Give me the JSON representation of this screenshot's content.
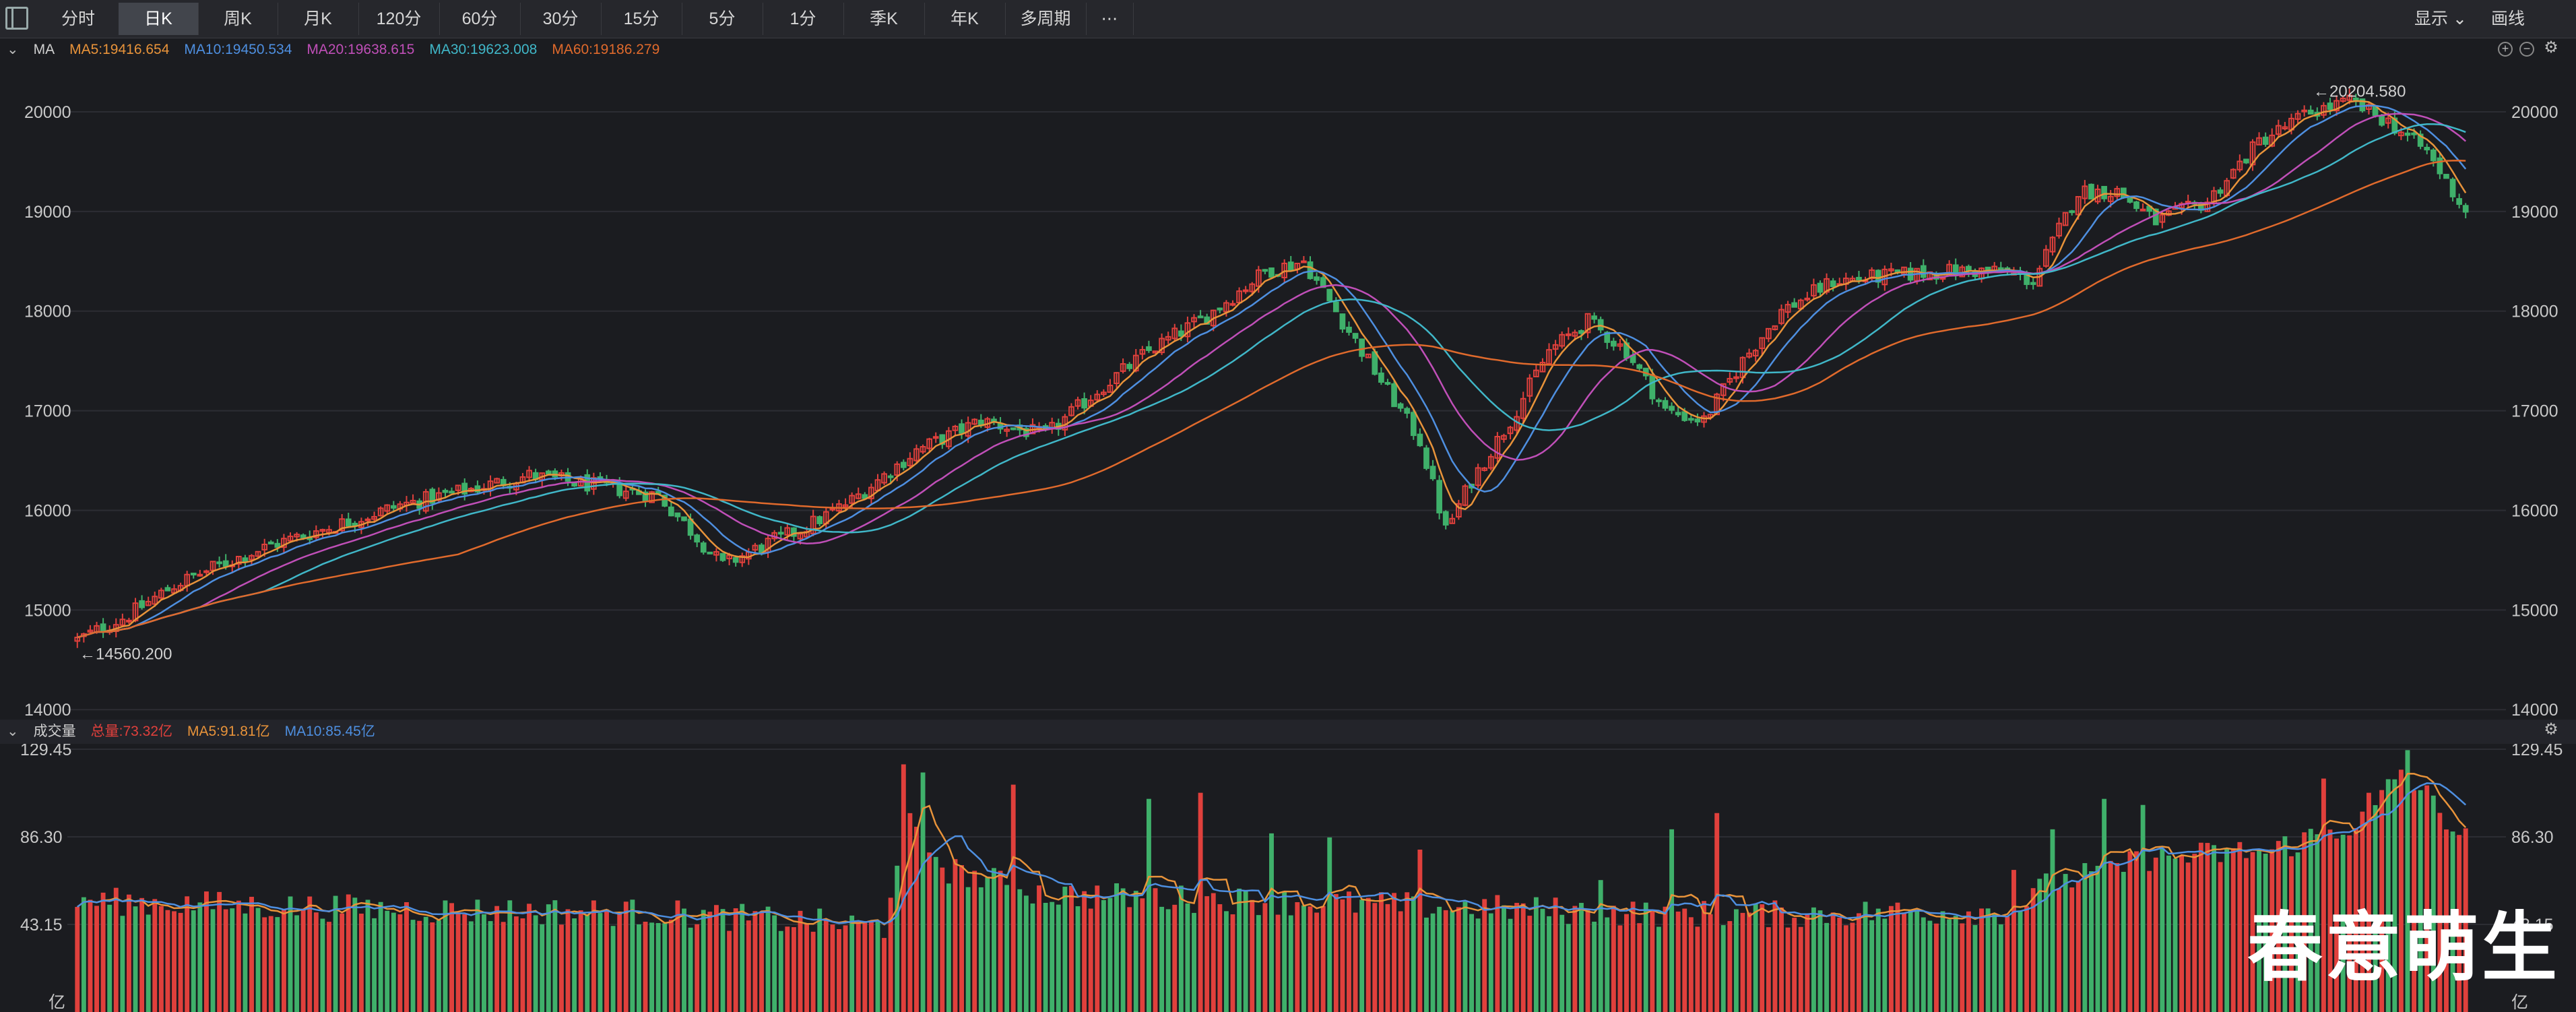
{
  "toolbar": {
    "tabs": [
      "分时",
      "日K",
      "周K",
      "月K",
      "120分",
      "60分",
      "30分",
      "15分",
      "5分",
      "1分",
      "季K",
      "年K",
      "多周期",
      "⋯"
    ],
    "active_tab": 1,
    "display_label": "显示",
    "draw_label": "画线"
  },
  "indicators": {
    "ma_title": "MA",
    "ma5": "MA5:19416.654",
    "ma10": "MA10:19450.534",
    "ma20": "MA20:19638.615",
    "ma30": "MA30:19623.008",
    "ma60": "MA60:19186.279",
    "vol_title": "成交量",
    "vol_total": "总量:73.32亿",
    "vol_ma5": "MA5:91.81亿",
    "vol_ma10": "MA10:85.45亿"
  },
  "colors": {
    "up": "#e0403c",
    "down": "#3fb06a",
    "ma5": "#e8933a",
    "ma10": "#4e8fe0",
    "ma20": "#c04fb8",
    "ma30": "#40b7c8",
    "ma60": "#e06a2c"
  },
  "watermark": "春意萌生",
  "chart_data": [
    {
      "type": "candlestick",
      "title": "",
      "y_ticks": [
        "20000",
        "19000",
        "18000",
        "17000",
        "16000",
        "15000",
        "14000"
      ],
      "ylim": [
        13900,
        20500
      ],
      "grid": true,
      "annotations": [
        {
          "label": "←20204.580",
          "value": 20204.58
        },
        {
          "label": "←14560.200",
          "value": 14560.2
        }
      ],
      "keypoints": [
        [
          0,
          14700
        ],
        [
          8,
          14950
        ],
        [
          15,
          15250
        ],
        [
          22,
          15450
        ],
        [
          30,
          15650
        ],
        [
          40,
          15850
        ],
        [
          50,
          16050
        ],
        [
          60,
          16200
        ],
        [
          70,
          16350
        ],
        [
          80,
          16250
        ],
        [
          90,
          16150
        ],
        [
          100,
          15450
        ],
        [
          108,
          15700
        ],
        [
          112,
          15800
        ],
        [
          120,
          16100
        ],
        [
          130,
          16600
        ],
        [
          140,
          16900
        ],
        [
          150,
          16750
        ],
        [
          158,
          17200
        ],
        [
          166,
          17600
        ],
        [
          175,
          17950
        ],
        [
          184,
          18400
        ],
        [
          190,
          18500
        ],
        [
          196,
          17900
        ],
        [
          202,
          17300
        ],
        [
          208,
          16700
        ],
        [
          212,
          15800
        ],
        [
          216,
          16300
        ],
        [
          222,
          16900
        ],
        [
          228,
          17600
        ],
        [
          234,
          17900
        ],
        [
          240,
          17600
        ],
        [
          246,
          17000
        ],
        [
          252,
          16900
        ],
        [
          258,
          17500
        ],
        [
          264,
          18000
        ],
        [
          272,
          18300
        ],
        [
          280,
          18350
        ],
        [
          290,
          18400
        ],
        [
          298,
          18400
        ],
        [
          303,
          18300
        ],
        [
          310,
          19200
        ],
        [
          316,
          19200
        ],
        [
          322,
          18900
        ],
        [
          330,
          19100
        ],
        [
          338,
          19700
        ],
        [
          346,
          20000
        ],
        [
          352,
          20100
        ],
        [
          358,
          19900
        ],
        [
          364,
          19600
        ],
        [
          370,
          19000
        ]
      ],
      "ma_windows": [
        5,
        10,
        20,
        30,
        60
      ]
    },
    {
      "type": "bar",
      "title": "",
      "y_ticks": [
        "129.45",
        "86.30",
        "43.15",
        "亿"
      ],
      "unit": "亿",
      "ylim": [
        0,
        129.45
      ],
      "keypoints": [
        [
          0,
          55
        ],
        [
          30,
          52
        ],
        [
          60,
          50
        ],
        [
          90,
          49
        ],
        [
          110,
          45
        ],
        [
          125,
          42
        ],
        [
          128,
          95
        ],
        [
          135,
          70
        ],
        [
          150,
          58
        ],
        [
          180,
          55
        ],
        [
          210,
          52
        ],
        [
          240,
          49
        ],
        [
          260,
          48
        ],
        [
          300,
          50
        ],
        [
          305,
          62
        ],
        [
          320,
          75
        ],
        [
          340,
          80
        ],
        [
          355,
          95
        ],
        [
          360,
          120
        ],
        [
          370,
          85
        ]
      ],
      "spikes": [
        [
          128,
          122
        ],
        [
          131,
          118
        ],
        [
          145,
          112
        ],
        [
          166,
          105
        ],
        [
          174,
          108
        ],
        [
          185,
          88
        ],
        [
          194,
          86
        ],
        [
          208,
          80
        ],
        [
          236,
          65
        ],
        [
          247,
          90
        ],
        [
          254,
          98
        ],
        [
          300,
          70
        ],
        [
          306,
          90
        ],
        [
          314,
          105
        ],
        [
          320,
          102
        ],
        [
          339,
          78
        ],
        [
          348,
          115
        ],
        [
          355,
          108
        ],
        [
          361,
          129
        ]
      ]
    }
  ]
}
